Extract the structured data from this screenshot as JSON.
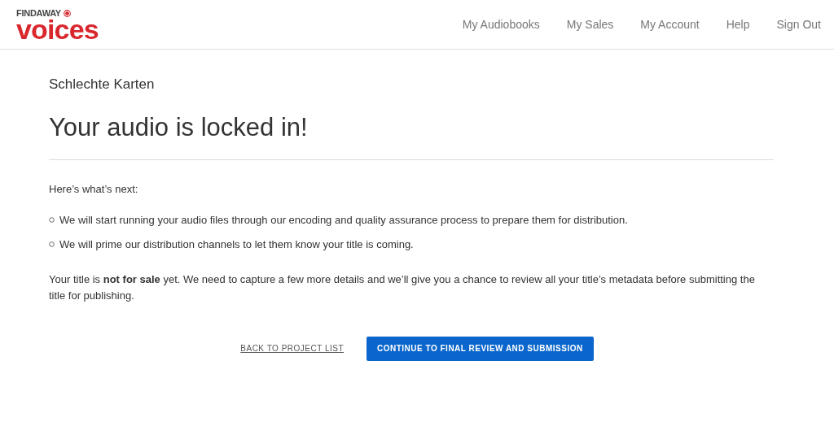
{
  "logo": {
    "top": "FINDAWAY",
    "bottom": "voices"
  },
  "nav": [
    {
      "label": "My Audiobooks"
    },
    {
      "label": "My Sales"
    },
    {
      "label": "My Account"
    },
    {
      "label": "Help"
    },
    {
      "label": "Sign Out"
    }
  ],
  "project_title": "Schlechte Karten",
  "heading": "Your audio is locked in!",
  "intro": "Here’s what’s next:",
  "steps": [
    "We will start running your audio files through our encoding and quality assurance process to prepare them for distribution.",
    "We will prime our distribution channels to let them know your title is coming."
  ],
  "note": "Your title is **not for sale** yet. We need to capture a few more details and we’ll give you a chance to review all your title’s metadata before submitting the title for publishing.",
  "back_link": "BACK TO PROJECT LIST",
  "continue_button": "CONTINUE TO FINAL REVIEW AND SUBMISSION"
}
